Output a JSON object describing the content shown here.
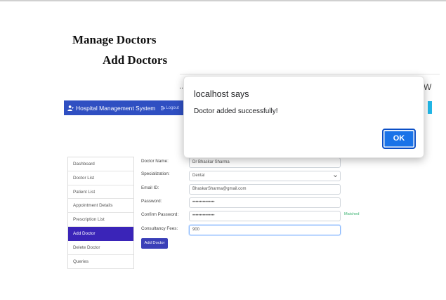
{
  "page": {
    "heading_manage": "Manage Doctors",
    "heading_add": "Add Doctors",
    "peek_left": "..",
    "peek_right": "W"
  },
  "navbar": {
    "brand": "Hospital Management System",
    "logout": "Logout",
    "brand_icon": "user-md-icon",
    "logout_icon": "sign-out-icon",
    "color": "#2f4fc2"
  },
  "sidebar": {
    "items": [
      {
        "label": "Dashboard"
      },
      {
        "label": "Doctor List"
      },
      {
        "label": "Patient List"
      },
      {
        "label": "Appointment Details"
      },
      {
        "label": "Prescription List"
      },
      {
        "label": "Add Doctor",
        "active": true
      },
      {
        "label": "Delete Doctor"
      },
      {
        "label": "Queries"
      }
    ],
    "active_color": "#3a24b8"
  },
  "form": {
    "doctor_name": {
      "label": "Doctor Name:",
      "value": "Dr Bhaskar Sharma"
    },
    "specialization": {
      "label": "Specialization:",
      "value": "Dental"
    },
    "email": {
      "label": "Email ID:",
      "value": "BhaskarSharma@gmail.com"
    },
    "password": {
      "label": "Password:",
      "value": "•••••••••••••••"
    },
    "confirm_password": {
      "label": "Confirm Password:",
      "value": "•••••••••••••••",
      "status": "Matched"
    },
    "fees": {
      "label": "Consultancy Fees:",
      "value": "900"
    },
    "submit_label": "Add Doctor"
  },
  "dialog": {
    "title": "localhost says",
    "message": "Doctor added successfully!",
    "ok_label": "OK",
    "button_color": "#1a73e8"
  }
}
